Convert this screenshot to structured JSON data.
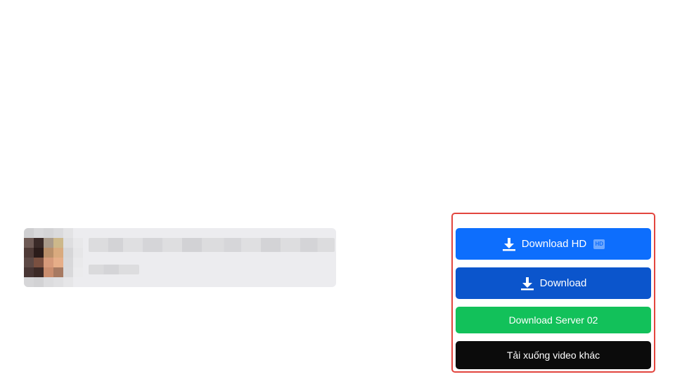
{
  "video": {
    "title": "",
    "subtitle": ""
  },
  "downloads": {
    "hd_label": "Download HD",
    "hd_badge": "HD",
    "download_label": "Download",
    "server2_label": "Download Server 02",
    "other_label": "Tải xuống video khác"
  },
  "colors": {
    "hd_button": "#0d6efd",
    "download_button": "#0b55cc",
    "server2_button": "#12c15a",
    "other_button": "#0b0b0b",
    "highlight_border": "#e2453e"
  },
  "icons": {
    "download": "download-arrow-icon",
    "hd_badge": "hd-badge-icon"
  }
}
